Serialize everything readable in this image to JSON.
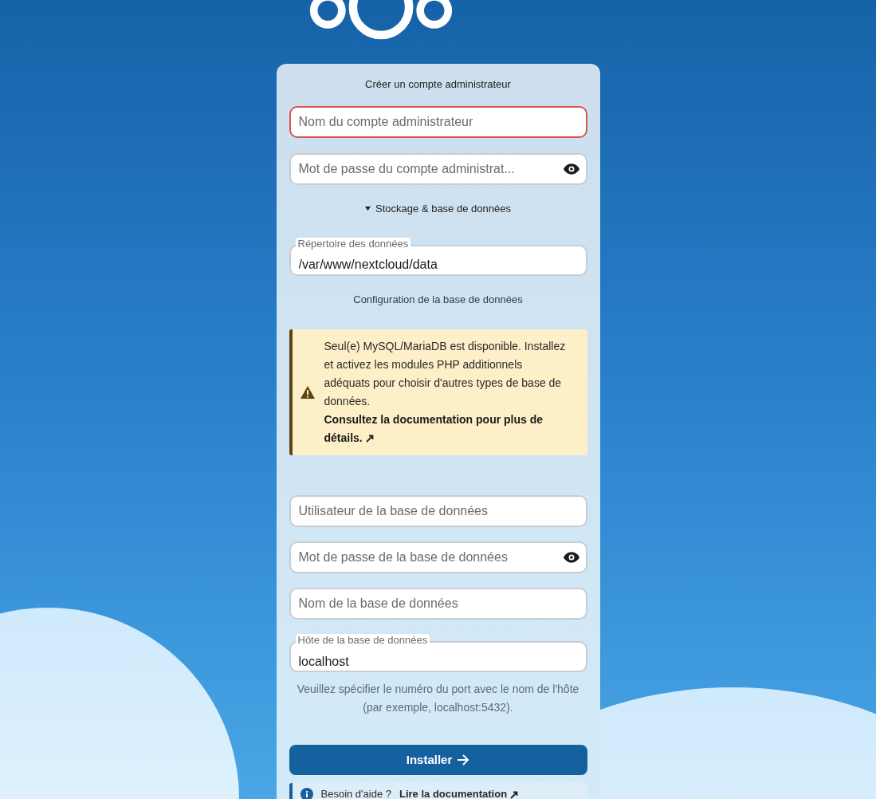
{
  "title": "Créer un compte administrateur",
  "admin_fields": [
    {
      "kind": "text",
      "placeholder": "Nom du compte administrateur",
      "invalid": true
    },
    {
      "kind": "password",
      "placeholder": "Mot de passe du compte administrat...",
      "invalid": false
    }
  ],
  "storage_toggle": {
    "label": "Stockage & base de données",
    "expanded": true
  },
  "data_dir": {
    "label": "Répertoire des données",
    "value": "/var/www/nextcloud/data"
  },
  "db_heading": "Configuration de la base de données",
  "warning": {
    "text": "Seul(e) MySQL/MariaDB est disponible. Installez et activez les modules PHP additionnels adéquats pour choisir d'autres types de base de données.",
    "link": "Consultez la documentation pour plus de détails."
  },
  "db_fields": [
    {
      "kind": "text",
      "placeholder": "Utilisateur de la base de données",
      "invalid": false
    },
    {
      "kind": "password",
      "placeholder": "Mot de passe de la base de données",
      "invalid": false
    },
    {
      "kind": "text",
      "placeholder": "Nom de la base de données",
      "invalid": false
    },
    {
      "kind": "filled",
      "label": "Hôte de la base de données",
      "value": "localhost",
      "invalid": false
    }
  ],
  "hint": "Veuillez spécifier le numéro du port avec le nom de l'hôte (par exemple, localhost:5432).",
  "install_button": "Installer",
  "help": {
    "text": "Besoin d'aide ?",
    "link": "Lire la documentation"
  }
}
